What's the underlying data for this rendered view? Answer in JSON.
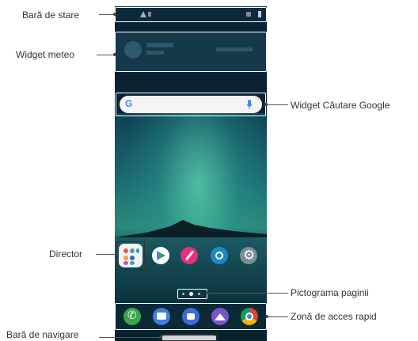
{
  "annotations": {
    "status_bar": "Bară de stare",
    "weather_widget": "Widget meteo",
    "google_search_widget": "Widget Căutare Google",
    "folder": "Director",
    "page_icon": "Pictograma paginii",
    "quick_access": "Zonă de acces rapid",
    "navigation_bar": "Bară de navigare"
  },
  "search": {
    "logo": "G"
  },
  "icons": {
    "home_apps": [
      "folder-icon",
      "play-store-icon",
      "notes-icon",
      "browser-icon",
      "settings-icon"
    ],
    "dock_apps": [
      "phone-icon",
      "messages-icon",
      "camera-icon",
      "gallery-icon",
      "chrome-icon"
    ]
  },
  "colors": {
    "outline": "#ffffff",
    "annotation_line": "#555555"
  }
}
